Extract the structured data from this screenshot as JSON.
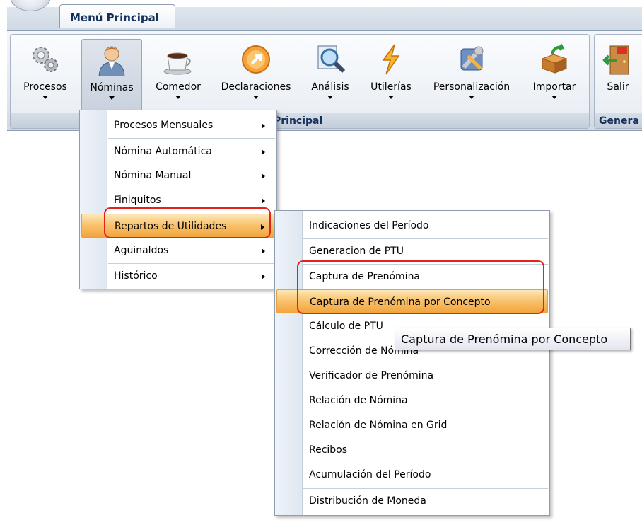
{
  "ribbon": {
    "active_tab": "Menú Principal",
    "group_main_label": "Principal",
    "group_general_label": "Genera",
    "buttons": [
      {
        "label": "Procesos",
        "icon": "gears-icon"
      },
      {
        "label": "Nóminas",
        "icon": "person-icon"
      },
      {
        "label": "Comedor",
        "icon": "coffee-cup-icon"
      },
      {
        "label": "Declaraciones",
        "icon": "orange-arrow-icon"
      },
      {
        "label": "Análisis",
        "icon": "magnifier-icon"
      },
      {
        "label": "Utilerías",
        "icon": "lightning-icon"
      },
      {
        "label": "Personalización",
        "icon": "tools-icon"
      },
      {
        "label": "Importar",
        "icon": "import-box-icon"
      },
      {
        "label": "Salir",
        "icon": "exit-door-icon"
      }
    ]
  },
  "nominas_menu": {
    "items": [
      {
        "label": "Procesos Mensuales"
      },
      {
        "label": "Nómina Automática"
      },
      {
        "label": "Nómina Manual"
      },
      {
        "label": "Finiquitos"
      },
      {
        "label": "Repartos de Utilidades"
      },
      {
        "label": "Aguinaldos"
      },
      {
        "label": "Histórico"
      }
    ]
  },
  "repartos_menu": {
    "items": [
      {
        "label": "Indicaciones del Período"
      },
      {
        "label": "Generacion de PTU"
      },
      {
        "label": "Captura de Prenómina"
      },
      {
        "label": "Captura de Prenómina por Concepto"
      },
      {
        "label": "Cálculo de PTU"
      },
      {
        "label": "Corrección de Nómina"
      },
      {
        "label": "Verificador de Prenómina"
      },
      {
        "label": "Relación de Nómina"
      },
      {
        "label": "Relación de Nómina en Grid"
      },
      {
        "label": "Recibos"
      },
      {
        "label": "Acumulación del Período"
      },
      {
        "label": "Distribución de Moneda"
      }
    ]
  },
  "tooltip": {
    "text": "Captura de Prenómina por Concepto"
  },
  "colors": {
    "highlight": "#f8c470",
    "annotation_red": "#e2231a",
    "ribbon_text": "#15305a"
  }
}
